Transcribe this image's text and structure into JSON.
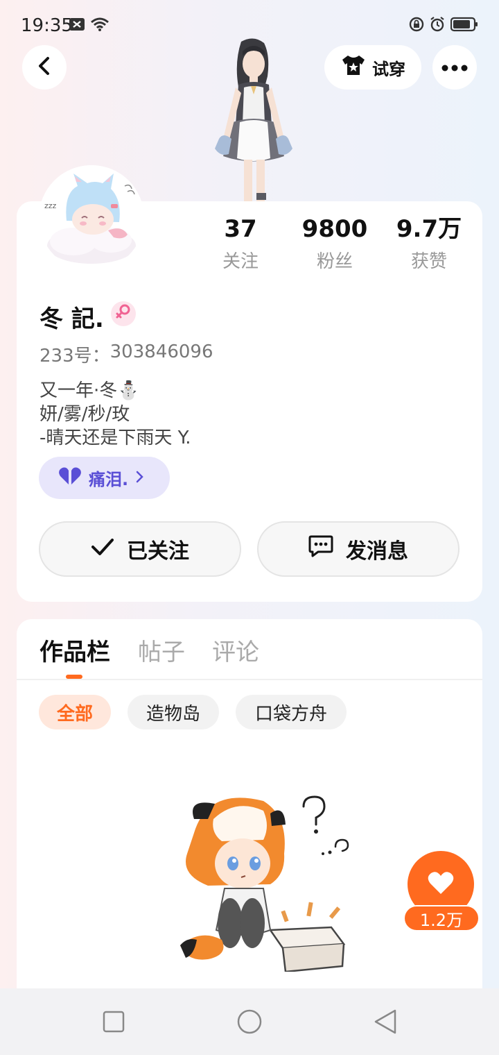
{
  "status_bar": {
    "time": "19:35",
    "left_icons": [
      "notification-icon",
      "wifi-icon"
    ],
    "right_icons": [
      "lock-rotation-icon",
      "alarm-icon",
      "battery-icon"
    ]
  },
  "header": {
    "try_on_label": "试穿"
  },
  "stats": [
    {
      "value": "37",
      "label": "关注"
    },
    {
      "value": "9800",
      "label": "粉丝"
    },
    {
      "value": "9.7万",
      "label": "获赞"
    }
  ],
  "profile": {
    "username": "冬 記.",
    "gender": "female",
    "uid_prefix": "233号：",
    "uid": "303846096",
    "bio": [
      "又一年·冬⛄",
      "妍/雾/秒/玫",
      "-晴天还是下雨天 Y."
    ],
    "group_chip_label": "痛泪."
  },
  "actions": {
    "follow_label": "已关注",
    "message_label": "发消息"
  },
  "tabs": [
    {
      "label": "作品栏",
      "active": true
    },
    {
      "label": "帖子",
      "active": false
    },
    {
      "label": "评论",
      "active": false
    }
  ],
  "filters": [
    {
      "label": "全部",
      "active": true
    },
    {
      "label": "造物岛",
      "active": false
    },
    {
      "label": "口袋方舟",
      "active": false
    }
  ],
  "like_button": {
    "count": "1.2万"
  },
  "colors": {
    "accent": "#ff6a1f",
    "chip_purple": "#5a4fd6",
    "gender_pink": "#f06292"
  }
}
